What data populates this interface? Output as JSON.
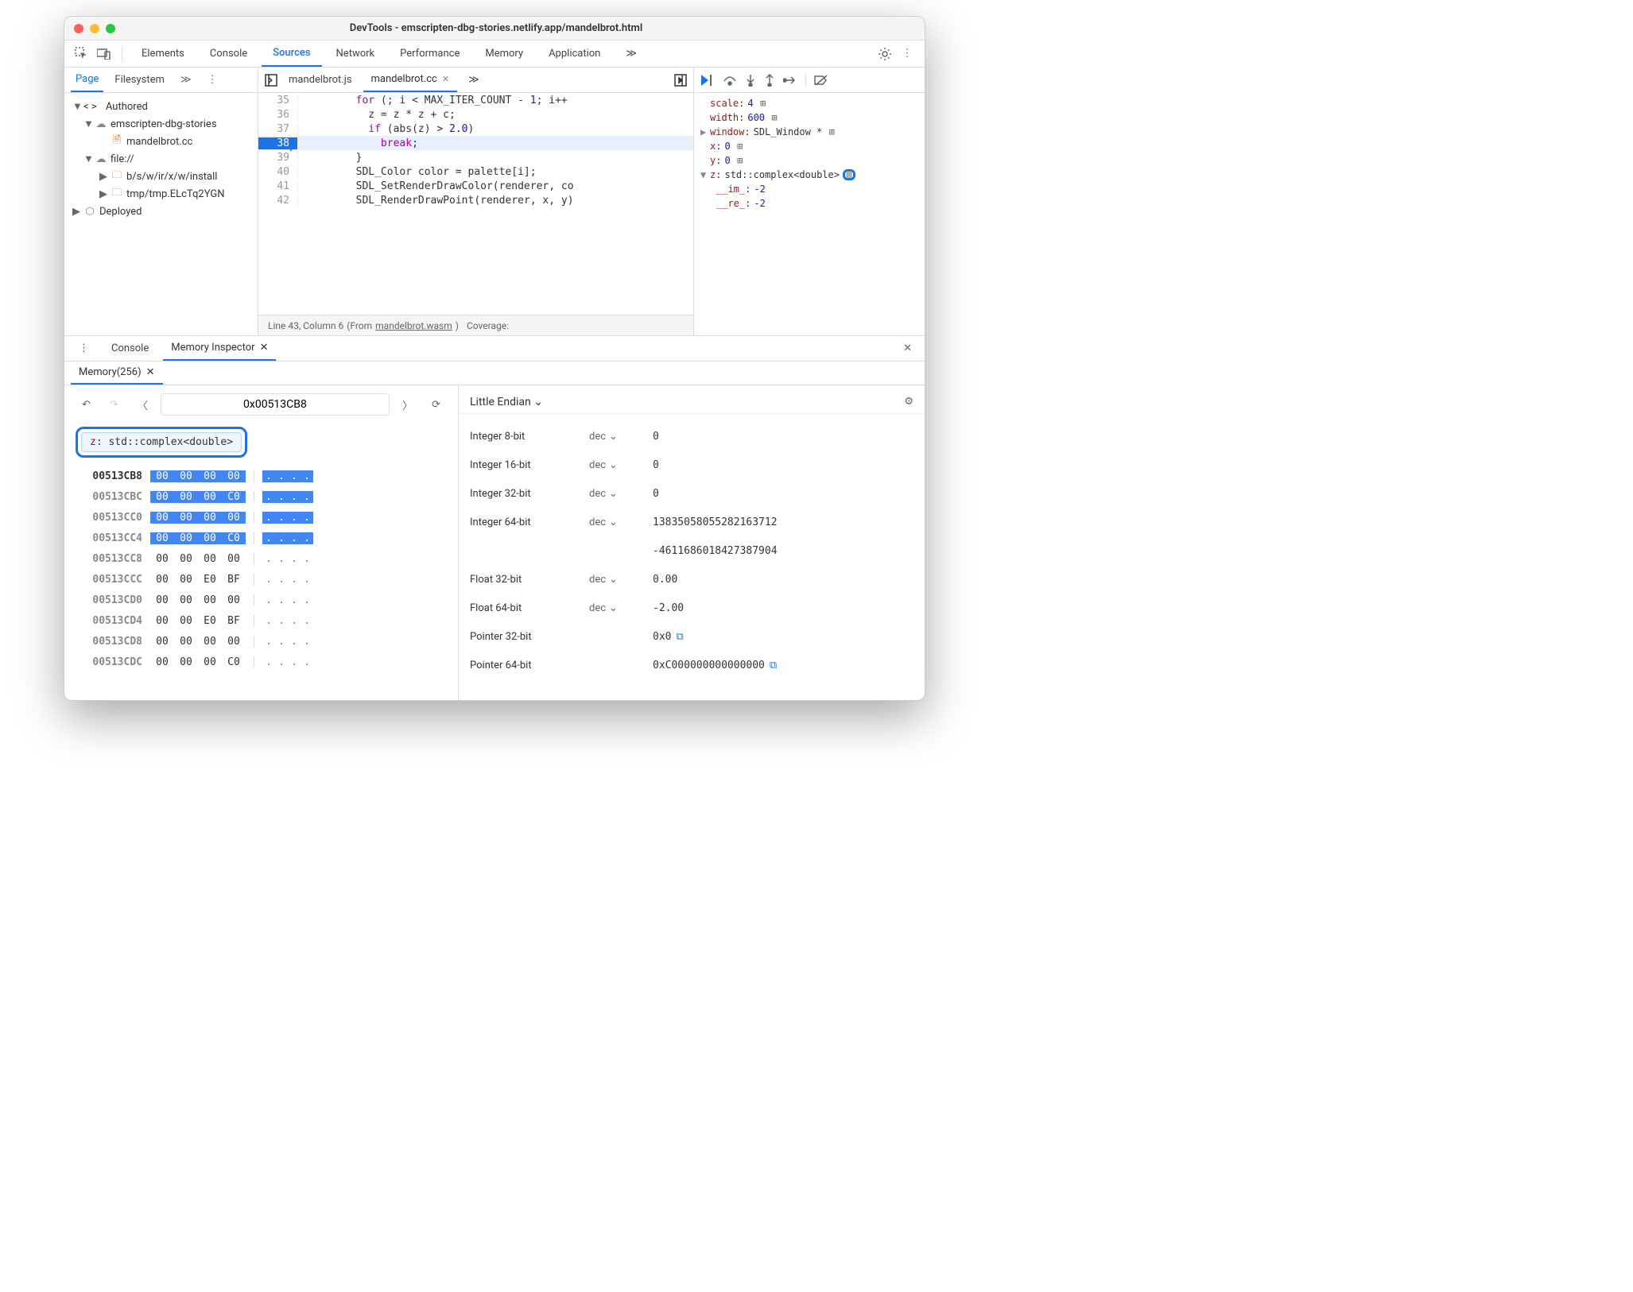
{
  "window": {
    "title": "DevTools - emscripten-dbg-stories.netlify.app/mandelbrot.html"
  },
  "mainTabs": {
    "items": [
      "Elements",
      "Console",
      "Sources",
      "Network",
      "Performance",
      "Memory",
      "Application"
    ],
    "active": "Sources",
    "overflow": "≫"
  },
  "sidebar": {
    "tabs": [
      "Page",
      "Filesystem"
    ],
    "active": "Page",
    "overflow": "≫",
    "tree": {
      "authored": "Authored",
      "host": "emscripten-dbg-stories",
      "file": "mandelbrot.cc",
      "fileHost": "file://",
      "folder1": "b/s/w/ir/x/w/install",
      "folder2": "tmp/tmp.ELcTq2YGN",
      "deployed": "Deployed"
    }
  },
  "editor": {
    "tabs": {
      "js": "mandelbrot.js",
      "cc": "mandelbrot.cc"
    },
    "overflow": "≫",
    "code": {
      "l35": "        for (; i < MAX_ITER_COUNT - 1; i++",
      "l36": "          z = z * z + c;",
      "l37": "          if (abs(z) > 2.0)",
      "l38": "            break;",
      "l39": "        }",
      "l40": "        SDL_Color color = palette[i];",
      "l41": "        SDL_SetRenderDrawColor(renderer, co",
      "l42": "        SDL_RenderDrawPoint(renderer, x, y)",
      "n35": "35",
      "n36": "36",
      "n37": "37",
      "n38": "38",
      "n39": "39",
      "n40": "40",
      "n41": "41",
      "n42": "42"
    },
    "status": {
      "pos": "Line 43, Column 6",
      "from": "(From ",
      "wasm": "mandelbrot.wasm",
      "cov": "Coverage:"
    }
  },
  "scope": {
    "scale": {
      "key": "scale",
      "val": "4"
    },
    "width": {
      "key": "width",
      "val": "600"
    },
    "window": {
      "key": "window",
      "val": "SDL_Window *"
    },
    "x": {
      "key": "x",
      "val": "0"
    },
    "y": {
      "key": "y",
      "val": "0"
    },
    "z": {
      "key": "z",
      "val": "std::complex<double>"
    },
    "im": {
      "key": "__im_",
      "val": "-2"
    },
    "re": {
      "key": "__re_",
      "val": "-2"
    }
  },
  "drawer": {
    "tabs": {
      "console": "Console",
      "mem": "Memory Inspector"
    },
    "subtab": "Memory(256)"
  },
  "memory": {
    "address": "0x00513CB8",
    "chip": {
      "key": "z",
      "type": "std::complex<double>"
    },
    "rows": [
      {
        "addr": "00513CB8",
        "bytes": [
          "00",
          "00",
          "00",
          "00"
        ],
        "ascii": [
          ".",
          ".",
          ".",
          "."
        ],
        "hl": true,
        "bold": true
      },
      {
        "addr": "00513CBC",
        "bytes": [
          "00",
          "00",
          "00",
          "C0"
        ],
        "ascii": [
          ".",
          ".",
          ".",
          "."
        ],
        "hl": true
      },
      {
        "addr": "00513CC0",
        "bytes": [
          "00",
          "00",
          "00",
          "00"
        ],
        "ascii": [
          ".",
          ".",
          ".",
          "."
        ],
        "hl": true
      },
      {
        "addr": "00513CC4",
        "bytes": [
          "00",
          "00",
          "00",
          "C0"
        ],
        "ascii": [
          ".",
          ".",
          ".",
          "."
        ],
        "hl": true
      },
      {
        "addr": "00513CC8",
        "bytes": [
          "00",
          "00",
          "00",
          "00"
        ],
        "ascii": [
          ".",
          ".",
          ".",
          "."
        ],
        "hl": false
      },
      {
        "addr": "00513CCC",
        "bytes": [
          "00",
          "00",
          "E0",
          "BF"
        ],
        "ascii": [
          ".",
          ".",
          ".",
          "."
        ],
        "hl": false
      },
      {
        "addr": "00513CD0",
        "bytes": [
          "00",
          "00",
          "00",
          "00"
        ],
        "ascii": [
          ".",
          ".",
          ".",
          "."
        ],
        "hl": false
      },
      {
        "addr": "00513CD4",
        "bytes": [
          "00",
          "00",
          "E0",
          "BF"
        ],
        "ascii": [
          ".",
          ".",
          ".",
          "."
        ],
        "hl": false
      },
      {
        "addr": "00513CD8",
        "bytes": [
          "00",
          "00",
          "00",
          "00"
        ],
        "ascii": [
          ".",
          ".",
          ".",
          "."
        ],
        "hl": false
      },
      {
        "addr": "00513CDC",
        "bytes": [
          "00",
          "00",
          "00",
          "C0"
        ],
        "ascii": [
          ".",
          ".",
          ".",
          "."
        ],
        "hl": false
      }
    ],
    "endian": "Little Endian",
    "values": {
      "i8": {
        "label": "Integer 8-bit",
        "mode": "dec",
        "val": "0"
      },
      "i16": {
        "label": "Integer 16-bit",
        "mode": "dec",
        "val": "0"
      },
      "i32": {
        "label": "Integer 32-bit",
        "mode": "dec",
        "val": "0"
      },
      "i64": {
        "label": "Integer 64-bit",
        "mode": "dec",
        "val": "13835058055282163712",
        "val2": "-4611686018427387904"
      },
      "f32": {
        "label": "Float 32-bit",
        "mode": "dec",
        "val": "0.00"
      },
      "f64": {
        "label": "Float 64-bit",
        "mode": "dec",
        "val": "-2.00"
      },
      "p32": {
        "label": "Pointer 32-bit",
        "val": "0x0"
      },
      "p64": {
        "label": "Pointer 64-bit",
        "val": "0xC000000000000000"
      }
    }
  }
}
